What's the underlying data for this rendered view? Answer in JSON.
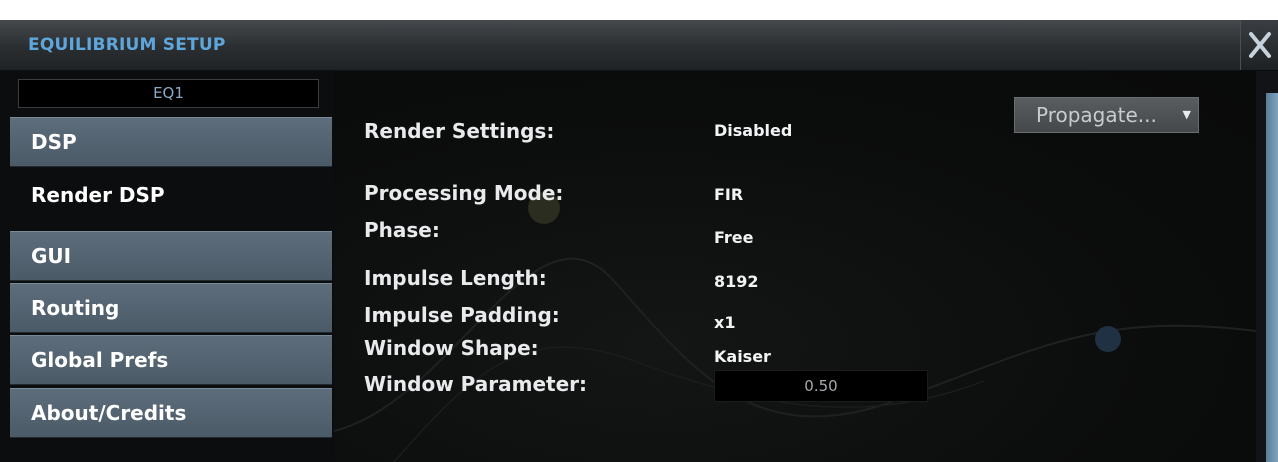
{
  "window": {
    "title": "EQUILIBRIUM SETUP",
    "close_icon": "close-icon"
  },
  "sidebar": {
    "preset": "EQ1",
    "items": [
      {
        "label": "DSP",
        "active": false
      },
      {
        "label": "Render DSP",
        "active": true
      },
      {
        "label": "GUI",
        "active": false
      },
      {
        "label": "Routing",
        "active": false
      },
      {
        "label": "Global Prefs",
        "active": false
      },
      {
        "label": "About/Credits",
        "active": false
      }
    ]
  },
  "settings": {
    "render_settings_label": "Render Settings:",
    "render_settings_value": "Disabled",
    "propagate_label": "Propagate...",
    "propagate_icon": "dropdown-arrow-icon",
    "processing_mode_label": "Processing Mode:",
    "processing_mode_value": "FIR",
    "phase_label": "Phase:",
    "phase_value": "Free",
    "impulse_length_label": "Impulse Length:",
    "impulse_length_value": "8192",
    "impulse_padding_label": "Impulse Padding:",
    "impulse_padding_value": "x1",
    "window_shape_label": "Window Shape:",
    "window_shape_value": "Kaiser",
    "window_parameter_label": "Window Parameter:",
    "window_parameter_value": "0.50"
  },
  "colors": {
    "title": "#5ea7dc",
    "sidebar_item": "#56656f",
    "background": "#0b0c0d"
  }
}
